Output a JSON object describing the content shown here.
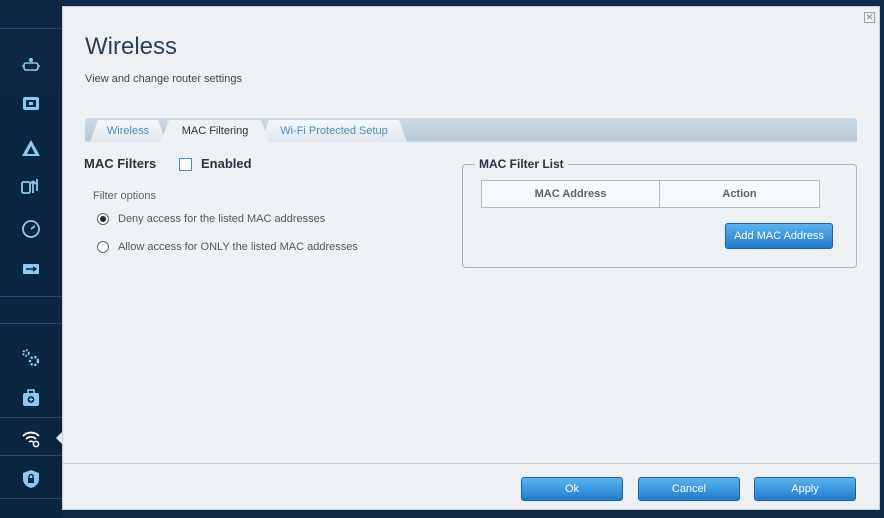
{
  "page": {
    "title": "Wireless",
    "subtitle": "View and change router settings",
    "close_symbol": "✕"
  },
  "sidebar": {
    "items": [
      {
        "icon": "network-map-icon"
      },
      {
        "icon": "parental-controls-icon"
      },
      {
        "icon": "troubleshooting-icon"
      },
      {
        "icon": "media-prioritization-icon"
      },
      {
        "icon": "speed-test-icon"
      },
      {
        "icon": "usb-storage-icon"
      },
      {
        "icon": "connectivity-icon"
      },
      {
        "icon": "troubleshooting-tool-icon"
      },
      {
        "icon": "wireless-icon",
        "active": true
      },
      {
        "icon": "security-icon"
      }
    ]
  },
  "tabs": [
    {
      "label": "Wireless",
      "active": false
    },
    {
      "label": "MAC Filtering",
      "active": true
    },
    {
      "label": "Wi-Fi Protected Setup",
      "active": false
    }
  ],
  "mac_filters": {
    "label": "MAC Filters",
    "enabled_label": "Enabled",
    "enabled": false,
    "filter_options_label": "Filter options",
    "options": [
      {
        "label": "Deny access for the listed MAC addresses",
        "selected": true
      },
      {
        "label": "Allow access for ONLY the listed MAC addresses",
        "selected": false
      }
    ]
  },
  "mac_filter_list": {
    "legend": "MAC Filter List",
    "columns": [
      "MAC Address",
      "Action"
    ],
    "add_button": "Add MAC Address"
  },
  "footer": {
    "ok": "Ok",
    "cancel": "Cancel",
    "apply": "Apply"
  },
  "colors": {
    "sidebar_bg": "#0b2744",
    "accent": "#1f7ccd",
    "panel_bg": "#eef1f3",
    "icon": "#8ec9ef"
  }
}
